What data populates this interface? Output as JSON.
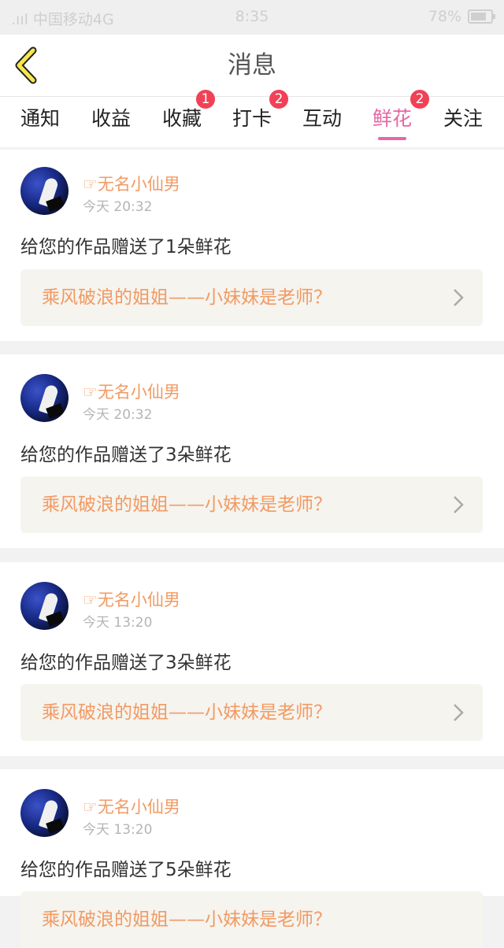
{
  "status_bar": {
    "carrier": ".ııl 中国移动4G",
    "time": "8:35",
    "battery": "78%",
    "battery_level": 0.78
  },
  "nav": {
    "title": "消息",
    "back_icon": "chevron-left-icon"
  },
  "tabs": [
    {
      "label": "通知",
      "badge": "",
      "active": false
    },
    {
      "label": "收益",
      "badge": "",
      "active": false
    },
    {
      "label": "收藏",
      "badge": "1",
      "active": false
    },
    {
      "label": "打卡",
      "badge": "2",
      "active": false
    },
    {
      "label": "互动",
      "badge": "",
      "active": false
    },
    {
      "label": "鲜花",
      "badge": "2",
      "active": true
    },
    {
      "label": "关注",
      "badge": "",
      "active": false
    }
  ],
  "colors": {
    "accent": "#e567a6",
    "username": "#f29a63",
    "badge": "#f14157"
  },
  "messages": [
    {
      "user": "☞无名小仙男",
      "time": "今天 20:32",
      "text": "给您的作品赠送了1朵鲜花",
      "work": "乘风破浪的姐姐——小妹妹是老师？"
    },
    {
      "user": "☞无名小仙男",
      "time": "今天 20:32",
      "text": "给您的作品赠送了3朵鲜花",
      "work": "乘风破浪的姐姐——小妹妹是老师？"
    },
    {
      "user": "☞无名小仙男",
      "time": "今天 13:20",
      "text": "给您的作品赠送了3朵鲜花",
      "work": "乘风破浪的姐姐——小妹妹是老师？"
    },
    {
      "user": "☞无名小仙男",
      "time": "今天 13:20",
      "text": "给您的作品赠送了5朵鲜花",
      "work": "乘风破浪的姐姐——小妹妹是老师？"
    }
  ]
}
